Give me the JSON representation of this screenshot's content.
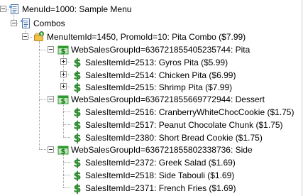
{
  "tree": {
    "root": {
      "label": "MenuId=1000: Sample Menu"
    },
    "combos": {
      "label": "Combos"
    },
    "menu_item": {
      "label": "MenuItemId=1450, PromoId=10: Pita Combo ($7.99)"
    },
    "groups": [
      {
        "label": "WebSalesGroupId=636721855405235744: Pita",
        "items": [
          {
            "label": "SalesItemId=2513: Gyros Pita ($5.99)"
          },
          {
            "label": "SalesItemId=2514: Chicken Pita ($6.99)"
          },
          {
            "label": "SalesItemId=2515: Shrimp Pita ($7.99)"
          }
        ]
      },
      {
        "label": "WebSalesGroupId=636721855669772944: Dessert",
        "items": [
          {
            "label": "SalesItemId=2516: CranberryWhiteChocCookie ($1.75)"
          },
          {
            "label": "SalesItemId=2517: Peanut Chocolate Chunk ($1.75)"
          },
          {
            "label": "SalesItemId=2380: Short Bread Cookie ($1.75)"
          }
        ]
      },
      {
        "label": "WebSalesGroupId=636721855802338736: Side",
        "items": [
          {
            "label": "SalesItemId=2372: Greek Salad ($1.69)"
          },
          {
            "label": "SalesItemId=2518: Side Tabouli ($1.69)"
          },
          {
            "label": "SalesItemId=2371: French Fries ($1.69)"
          }
        ]
      }
    ]
  },
  "icons": {
    "root": "menu-document-icon",
    "combos": "combos-document-icon",
    "menu_item": "combo-folder-icon",
    "group": "sales-group-dollar-icon",
    "item": "sales-item-dollar-icon"
  },
  "colors": {
    "dollar_green": "#2e9a2e",
    "folder_yellow": "#f0c24a"
  }
}
